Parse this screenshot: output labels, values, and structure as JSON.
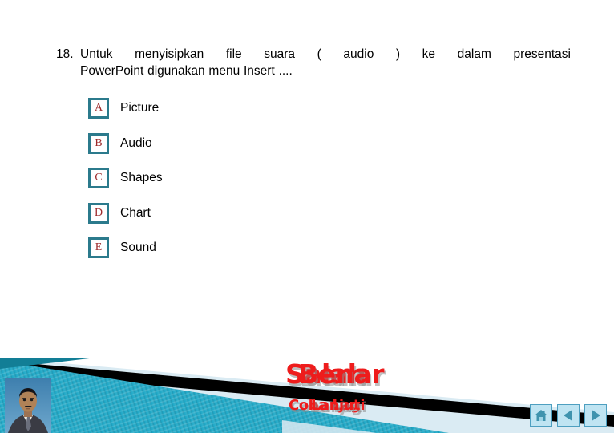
{
  "slide": {
    "background_color": "#ffffff",
    "question": {
      "number": "18.",
      "line1": "Untuk menyisipkan file suara ( audio ) ke dalam presentasi",
      "line2": "PowerPoint digunakan menu Insert ....",
      "full_text": "18. Untuk menyisipkan file suara ( audio ) ke dalam presentasi PowerPoint digunakan menu Insert ...."
    },
    "options": [
      {
        "key": "A",
        "label": "Picture"
      },
      {
        "key": "B",
        "label": "Audio"
      },
      {
        "key": "C",
        "label": "Shapes"
      },
      {
        "key": "D",
        "label": "Chart"
      },
      {
        "key": "E",
        "label": "Sound"
      }
    ],
    "feedback": {
      "wrong_title": "Salah",
      "correct_title": "Benar",
      "wrong_action": "Coba Lagi",
      "correct_action": "Lanjut"
    },
    "nav": {
      "home_label": "home-button",
      "prev_label": "previous-button",
      "next_label": "next-button"
    },
    "decor": {
      "band_teal": "#2fa8c4",
      "band_teal_dark": "#127e96",
      "band_black": "#000000",
      "band_pale": "#d6e9f2",
      "accent_red": "#ee1c1c",
      "option_border": "#2b7a8c",
      "option_letter": "#9e2a2b",
      "nav_fill": "#bfe4f2",
      "nav_stroke": "#4e9fc0",
      "nav_glyph": "#3f93ae"
    },
    "avatar": {
      "alt": "presenter-portrait-photo"
    }
  }
}
